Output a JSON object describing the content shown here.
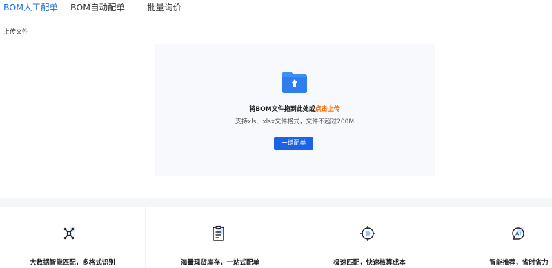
{
  "tabs": [
    {
      "label": "BOM人工配单",
      "active": true
    },
    {
      "label": "BOM自动配单",
      "active": false
    },
    {
      "label": "批量询价",
      "active": false
    }
  ],
  "upload": {
    "section_title": "上传文件",
    "prompt": "将BOM文件拖到此处或",
    "link": "点击上传",
    "hint": "支持xls、xlsx文件格式，文件不超过200M",
    "button": "一键配单",
    "icon": "folder-upload-icon"
  },
  "features": [
    {
      "label": "大数据智能匹配，多格式识别",
      "icon": "network-nodes-icon"
    },
    {
      "label": "海量现货库存，一站式配单",
      "icon": "clipboard-list-icon"
    },
    {
      "label": "极速匹配，快速核算成本",
      "icon": "target-icon"
    },
    {
      "label": "智能推荐，省时省力",
      "icon": "ai-chat-icon"
    }
  ],
  "colors": {
    "accent": "#1f6fe5",
    "button": "#1b63e6",
    "link": "#ff6a00",
    "upload_bg": "#f7f9fc"
  }
}
